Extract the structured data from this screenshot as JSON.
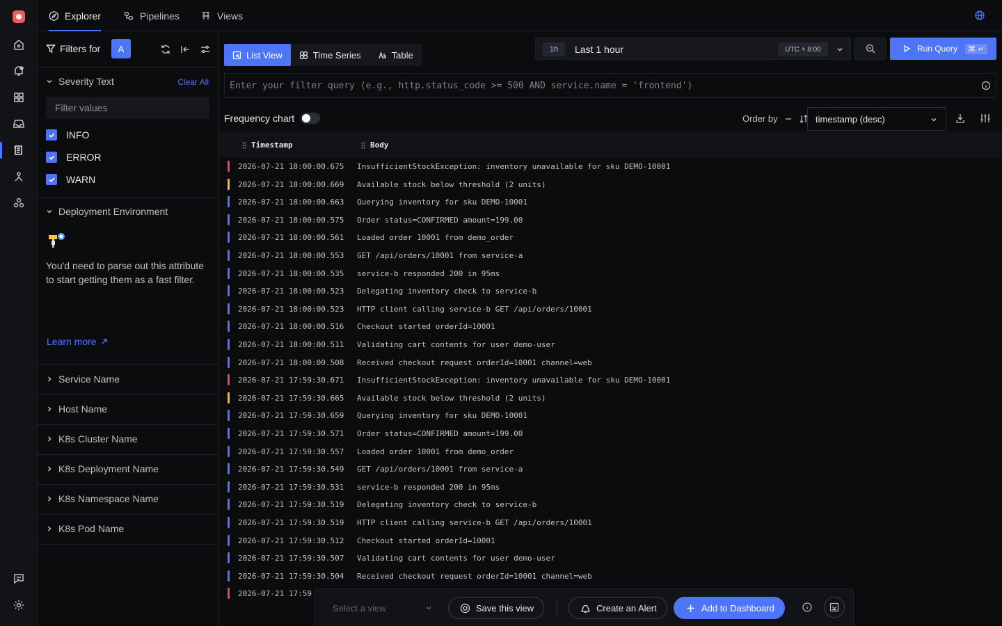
{
  "top_tabs": [
    {
      "label": "Explorer",
      "icon": "compass-icon",
      "active": true
    },
    {
      "label": "Pipelines",
      "icon": "pipeline-icon",
      "active": false
    },
    {
      "label": "Views",
      "icon": "views-icon",
      "active": false
    }
  ],
  "filters": {
    "title": "Filters for",
    "badge": "A",
    "severity": {
      "title": "Severity Text",
      "clear_all": "Clear All",
      "placeholder": "Filter values",
      "options": [
        "INFO",
        "ERROR",
        "WARN"
      ]
    },
    "deployment": {
      "title": "Deployment Environment",
      "hint": "You'd need to parse out this attribute to start getting them as a fast filter.",
      "learn_more": "Learn more"
    },
    "collapsed": [
      "Service Name",
      "Host Name",
      "K8s Cluster Name",
      "K8s Deployment Name",
      "K8s Namespace Name",
      "K8s Pod Name"
    ]
  },
  "view_tabs": [
    {
      "label": "List View",
      "active": true
    },
    {
      "label": "Time Series",
      "active": false
    },
    {
      "label": "Table",
      "active": false
    }
  ],
  "time_picker": {
    "chip": "1h",
    "label": "Last 1 hour",
    "timezone": "UTC + 8:00"
  },
  "run_query": {
    "label": "Run Query",
    "shortcut": "⌘ ↵"
  },
  "query": {
    "placeholder": "Enter your filter query (e.g., http.status_code >= 500 AND service.name = 'frontend')"
  },
  "frequency_chart": {
    "label": "Frequency chart",
    "enabled": false
  },
  "order": {
    "label": "Order by",
    "value": "timestamp (desc)"
  },
  "columns": [
    "Timestamp",
    "Body"
  ],
  "colors": {
    "accent": "#4e74f8",
    "error": "#e5484d",
    "warn": "#f5b840",
    "info": "#4e74f8"
  },
  "logs": [
    {
      "sev": "error",
      "ts": "2026-07-21 18:00:00.675",
      "body": "InsufficientStockException: inventory unavailable for sku DEMO-10001"
    },
    {
      "sev": "warn",
      "ts": "2026-07-21 18:00:00.669",
      "body": "Available stock below threshold (2 units)"
    },
    {
      "sev": "info",
      "ts": "2026-07-21 18:00:00.663",
      "body": "Querying inventory for sku DEMO-10001"
    },
    {
      "sev": "info",
      "ts": "2026-07-21 18:00:00.575",
      "body": "Order status=CONFIRMED amount=199.00"
    },
    {
      "sev": "info",
      "ts": "2026-07-21 18:00:00.561",
      "body": "Loaded order 10001 from demo_order"
    },
    {
      "sev": "info",
      "ts": "2026-07-21 18:00:00.553",
      "body": "GET /api/orders/10001 from service-a"
    },
    {
      "sev": "info",
      "ts": "2026-07-21 18:00:00.535",
      "body": "service-b responded 200 in 95ms"
    },
    {
      "sev": "info",
      "ts": "2026-07-21 18:00:00.523",
      "body": "Delegating inventory check to service-b"
    },
    {
      "sev": "info",
      "ts": "2026-07-21 18:00:00.523",
      "body": "HTTP client calling service-b GET /api/orders/10001"
    },
    {
      "sev": "info",
      "ts": "2026-07-21 18:00:00.516",
      "body": "Checkout started orderId=10001"
    },
    {
      "sev": "info",
      "ts": "2026-07-21 18:00:00.511",
      "body": "Validating cart contents for user demo-user"
    },
    {
      "sev": "info",
      "ts": "2026-07-21 18:00:00.508",
      "body": "Received checkout request orderId=10001 channel=web"
    },
    {
      "sev": "error",
      "ts": "2026-07-21 17:59:30.671",
      "body": "InsufficientStockException: inventory unavailable for sku DEMO-10001"
    },
    {
      "sev": "warn",
      "ts": "2026-07-21 17:59:30.665",
      "body": "Available stock below threshold (2 units)"
    },
    {
      "sev": "info",
      "ts": "2026-07-21 17:59:30.659",
      "body": "Querying inventory for sku DEMO-10001"
    },
    {
      "sev": "info",
      "ts": "2026-07-21 17:59:30.571",
      "body": "Order status=CONFIRMED amount=199.00"
    },
    {
      "sev": "info",
      "ts": "2026-07-21 17:59:30.557",
      "body": "Loaded order 10001 from demo_order"
    },
    {
      "sev": "info",
      "ts": "2026-07-21 17:59:30.549",
      "body": "GET /api/orders/10001 from service-a"
    },
    {
      "sev": "info",
      "ts": "2026-07-21 17:59:30.531",
      "body": "service-b responded 200 in 95ms"
    },
    {
      "sev": "info",
      "ts": "2026-07-21 17:59:30.519",
      "body": "Delegating inventory check to service-b"
    },
    {
      "sev": "info",
      "ts": "2026-07-21 17:59:30.519",
      "body": "HTTP client calling service-b GET /api/orders/10001"
    },
    {
      "sev": "info",
      "ts": "2026-07-21 17:59:30.512",
      "body": "Checkout started orderId=10001"
    },
    {
      "sev": "info",
      "ts": "2026-07-21 17:59:30.507",
      "body": "Validating cart contents for user demo-user"
    },
    {
      "sev": "info",
      "ts": "2026-07-21 17:59:30.504",
      "body": "Received checkout request orderId=10001 channel=web"
    },
    {
      "sev": "error",
      "ts": "2026-07-21 17:59",
      "body": ""
    }
  ],
  "bottom_bar": {
    "select_view": "Select a view",
    "save_view": "Save this view",
    "create_alert": "Create an Alert",
    "add_dashboard": "Add to Dashboard"
  }
}
